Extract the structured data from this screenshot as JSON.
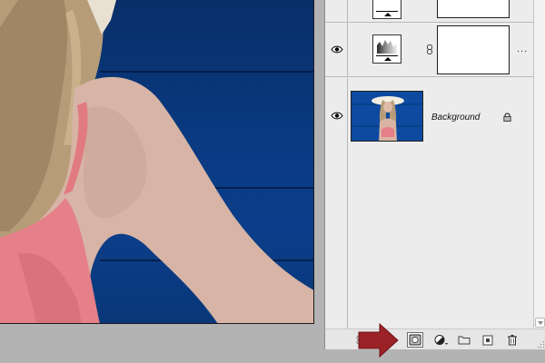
{
  "window": {
    "title": ""
  },
  "canvas": {
    "description_label": "",
    "background_color": "#0a3a82"
  },
  "layers_panel": {
    "layers": [
      {
        "id": "adjustment-1",
        "type": "adjustment",
        "visible": true,
        "name": "",
        "has_mask": true
      },
      {
        "id": "adjustment-2",
        "type": "adjustment",
        "visible": true,
        "name": "",
        "has_mask": true,
        "linked": true,
        "more_indicator": "..."
      },
      {
        "id": "background",
        "type": "image",
        "visible": true,
        "name": "Background",
        "locked": true
      }
    ],
    "footer_buttons": [
      {
        "name": "link-layers-button",
        "icon": "link-icon",
        "label": ""
      },
      {
        "name": "add-mask-button",
        "icon": "layer-mask-icon",
        "label": "",
        "highlighted": true
      },
      {
        "name": "new-adjustment-button",
        "icon": "adjustment-layer-icon",
        "label": ""
      },
      {
        "name": "new-group-button",
        "icon": "folder-icon",
        "label": ""
      },
      {
        "name": "new-layer-button",
        "icon": "new-layer-icon",
        "label": ""
      },
      {
        "name": "delete-layer-button",
        "icon": "trash-icon",
        "label": ""
      }
    ]
  },
  "annotation": {
    "arrow_color": "#9b2226",
    "points_to": "add-mask-button"
  }
}
